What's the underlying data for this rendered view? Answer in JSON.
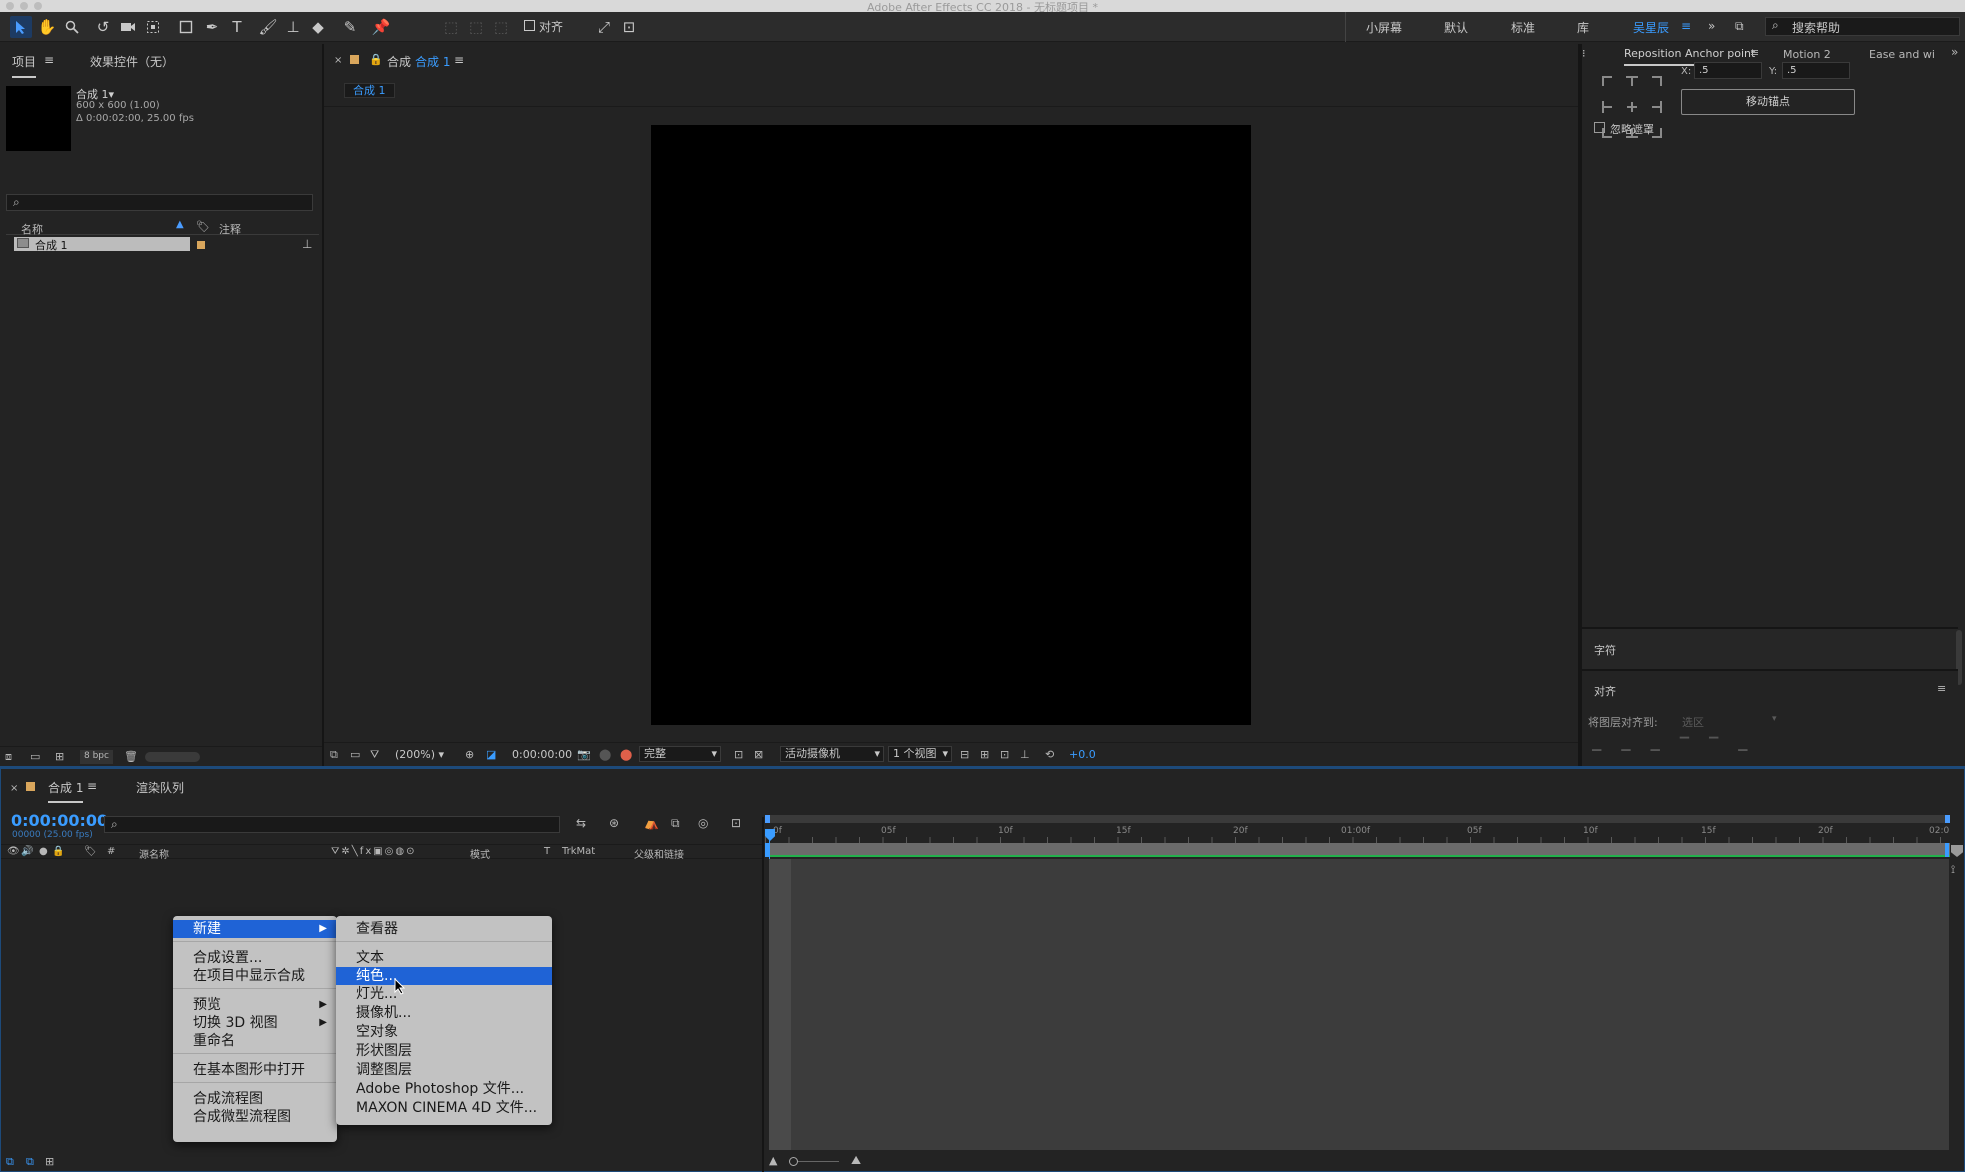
{
  "window": {
    "title": "Adobe After Effects CC 2018 - 无标题项目 *"
  },
  "toolbar": {
    "align_label": "对齐",
    "workspaces": [
      "小屏幕",
      "默认",
      "标准",
      "库",
      "吴星辰"
    ],
    "active_workspace": "吴星辰",
    "search_help": "搜索帮助"
  },
  "project_panel": {
    "tab_project": "项目",
    "tab_effects": "效果控件（无）",
    "comp_name": "合成 1▾",
    "comp_size": "600 x 600 (1.00)",
    "comp_duration": "Δ 0:00:02:00, 25.00 fps",
    "col_name": "名称",
    "col_comment": "注释",
    "item_name": "合成 1",
    "bpc": "8 bpc"
  },
  "comp_panel": {
    "tab_prefix": "合成",
    "tab_name": "合成 1",
    "crumb": "合成 1",
    "zoom": "(200%)",
    "timecode": "0:00:00:00",
    "quality": "完整",
    "camera": "活动摄像机",
    "views": "1 个视图",
    "exposure": "+0.0"
  },
  "anchor_panel": {
    "tab_active": "Reposition Anchor point",
    "tab_motion": "Motion 2",
    "tab_ease": "Ease and wi",
    "x_label": "X:",
    "x_value": ".5",
    "y_label": "Y:",
    "y_value": ".5",
    "move_button": "移动锚点",
    "ignore_mask": "忽略遮罩"
  },
  "character_panel": {
    "title": "字符"
  },
  "align_panel": {
    "title": "对齐",
    "align_to_label": "将图层对齐到:",
    "align_to_value": "选区"
  },
  "timeline": {
    "tab_comp": "合成 1",
    "tab_render": "渲染队列",
    "timecode": "0:00:00:00",
    "frames": "00000 (25.00 fps)",
    "col_num": "#",
    "col_source": "源名称",
    "col_mode": "模式",
    "col_t": "T",
    "col_trkmat": "TrkMat",
    "col_parent": "父级和链接",
    "ruler_labels": [
      "0f",
      "05f",
      "10f",
      "15f",
      "20f",
      "01:00f",
      "05f",
      "10f",
      "15f",
      "20f",
      "02:0"
    ]
  },
  "context_menu": {
    "items": [
      {
        "label": "新建",
        "submenu": true,
        "selected": true
      },
      {
        "label": "合成设置..."
      },
      {
        "label": "在项目中显示合成"
      },
      {
        "label": "预览",
        "submenu": true
      },
      {
        "label": "切换 3D 视图",
        "submenu": true
      },
      {
        "label": "重命名"
      },
      {
        "label": "在基本图形中打开"
      },
      {
        "label": "合成流程图"
      },
      {
        "label": "合成微型流程图"
      }
    ]
  },
  "submenu": {
    "items": [
      {
        "label": "查看器"
      },
      {
        "label": "文本"
      },
      {
        "label": "纯色...",
        "selected": true
      },
      {
        "label": "灯光..."
      },
      {
        "label": "摄像机..."
      },
      {
        "label": "空对象"
      },
      {
        "label": "形状图层"
      },
      {
        "label": "调整图层"
      },
      {
        "label": "Adobe Photoshop 文件..."
      },
      {
        "label": "MAXON CINEMA 4D 文件..."
      }
    ]
  },
  "colors": {
    "accent": "#3a9cff",
    "menu_bg": "#c2c2c2",
    "menu_selected": "#1f63d6",
    "work_area": "#22b14c"
  }
}
